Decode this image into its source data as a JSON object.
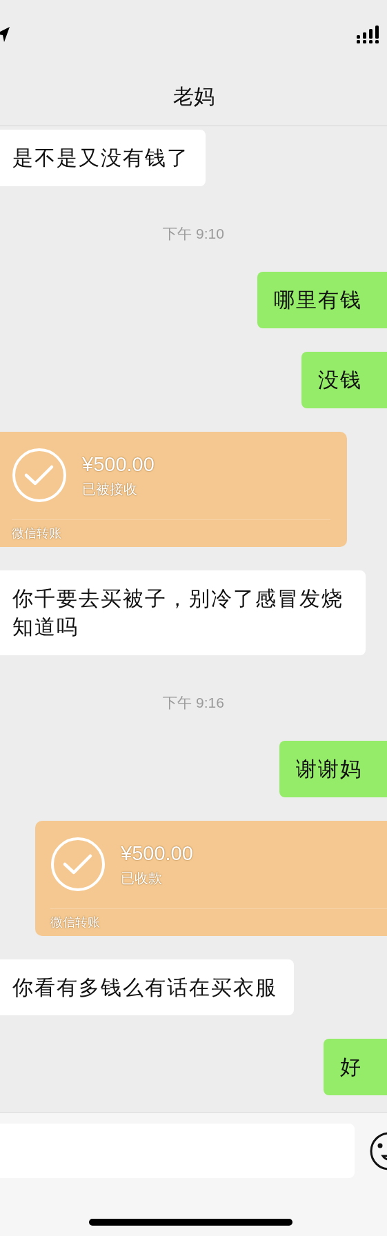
{
  "header": {
    "title": "老妈"
  },
  "messages": [
    {
      "kind": "text",
      "outgoing": false,
      "text": "是不是又没有钱了"
    },
    {
      "kind": "timestamp",
      "text": "下午 9:10"
    },
    {
      "kind": "text",
      "outgoing": true,
      "text": "哪里有钱"
    },
    {
      "kind": "text",
      "outgoing": true,
      "text": "没钱"
    },
    {
      "kind": "transfer",
      "outgoing": false,
      "amount": "¥500.00",
      "status": "已被接收",
      "label": "微信转账"
    },
    {
      "kind": "text",
      "outgoing": false,
      "text": "你千要去买被子，别冷了感冒发烧知道吗"
    },
    {
      "kind": "timestamp",
      "text": "下午 9:16"
    },
    {
      "kind": "text",
      "outgoing": true,
      "text": "谢谢妈"
    },
    {
      "kind": "transfer",
      "outgoing": true,
      "amount": "¥500.00",
      "status": "已收款",
      "label": "微信转账"
    },
    {
      "kind": "text",
      "outgoing": false,
      "text": "你看有多钱么有话在买衣服"
    },
    {
      "kind": "text",
      "outgoing": true,
      "text": "好"
    }
  ]
}
